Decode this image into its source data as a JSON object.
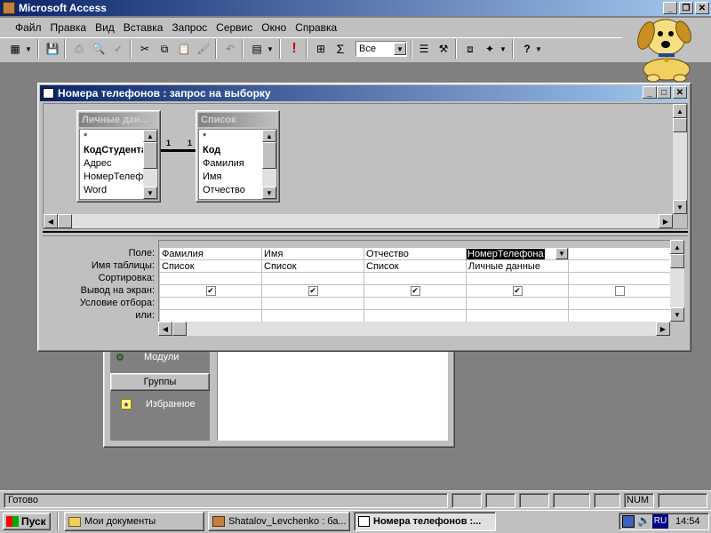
{
  "app": {
    "title": "Microsoft Access"
  },
  "menu": [
    "Файл",
    "Правка",
    "Вид",
    "Вставка",
    "Запрос",
    "Сервис",
    "Окно",
    "Справка"
  ],
  "toolbar": {
    "query_type": "Все"
  },
  "db_window": {
    "items": [
      "Модули"
    ],
    "groups_label": "Группы",
    "favorites_label": "Избранное"
  },
  "query_window": {
    "title": "Номера телефонов : запрос на выборку",
    "tables": [
      {
        "name": "Личные дан...",
        "fields": [
          "*",
          "КодСтудента",
          "Адрес",
          "НомерТелефо",
          "Word"
        ]
      },
      {
        "name": "Список",
        "fields": [
          "*",
          "Код",
          "Фамилия",
          "Имя",
          "Отчество"
        ]
      }
    ],
    "join_left": "1",
    "join_right": "1",
    "row_labels": [
      "Поле:",
      "Имя таблицы:",
      "Сортировка:",
      "Вывод на экран:",
      "Условие отбора:",
      "или:"
    ],
    "columns": [
      {
        "field": "Фамилия",
        "table": "Список",
        "show": true
      },
      {
        "field": "Имя",
        "table": "Список",
        "show": true
      },
      {
        "field": "Отчество",
        "table": "Список",
        "show": true
      },
      {
        "field": "НомерТелефона",
        "table": "Личные данные",
        "show": true
      },
      {
        "field": "",
        "table": "",
        "show": false
      }
    ]
  },
  "status": {
    "text": "Готово",
    "num": "NUM"
  },
  "taskbar": {
    "start": "Пуск",
    "tasks": [
      "Мои документы",
      "Shatalov_Levchenko : ба...",
      "Номера телефонов :..."
    ],
    "lang": "RU",
    "clock": "14:54"
  }
}
